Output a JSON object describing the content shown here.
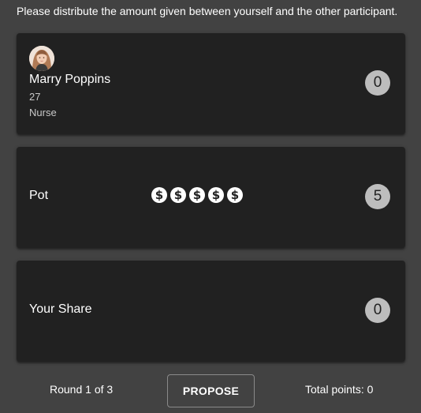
{
  "instruction": "Please distribute the amount given between yourself and the other participant.",
  "participant": {
    "name": "Marry Poppins",
    "age": "27",
    "occupation": "Nurse",
    "score": "0",
    "avatar_icon": "person-avatar"
  },
  "pot": {
    "label": "Pot",
    "coin_count": 5,
    "coin_icon": "dollar-coin-icon",
    "value": "5"
  },
  "share": {
    "label": "Your Share",
    "value": "0"
  },
  "footer": {
    "round": "Round 1 of 3",
    "propose_label": "PROPOSE",
    "total_points": "Total points: 0"
  },
  "colors": {
    "background": "#424242",
    "card": "#212121",
    "badge": "#bdbdbd",
    "text": "#ffffff"
  }
}
